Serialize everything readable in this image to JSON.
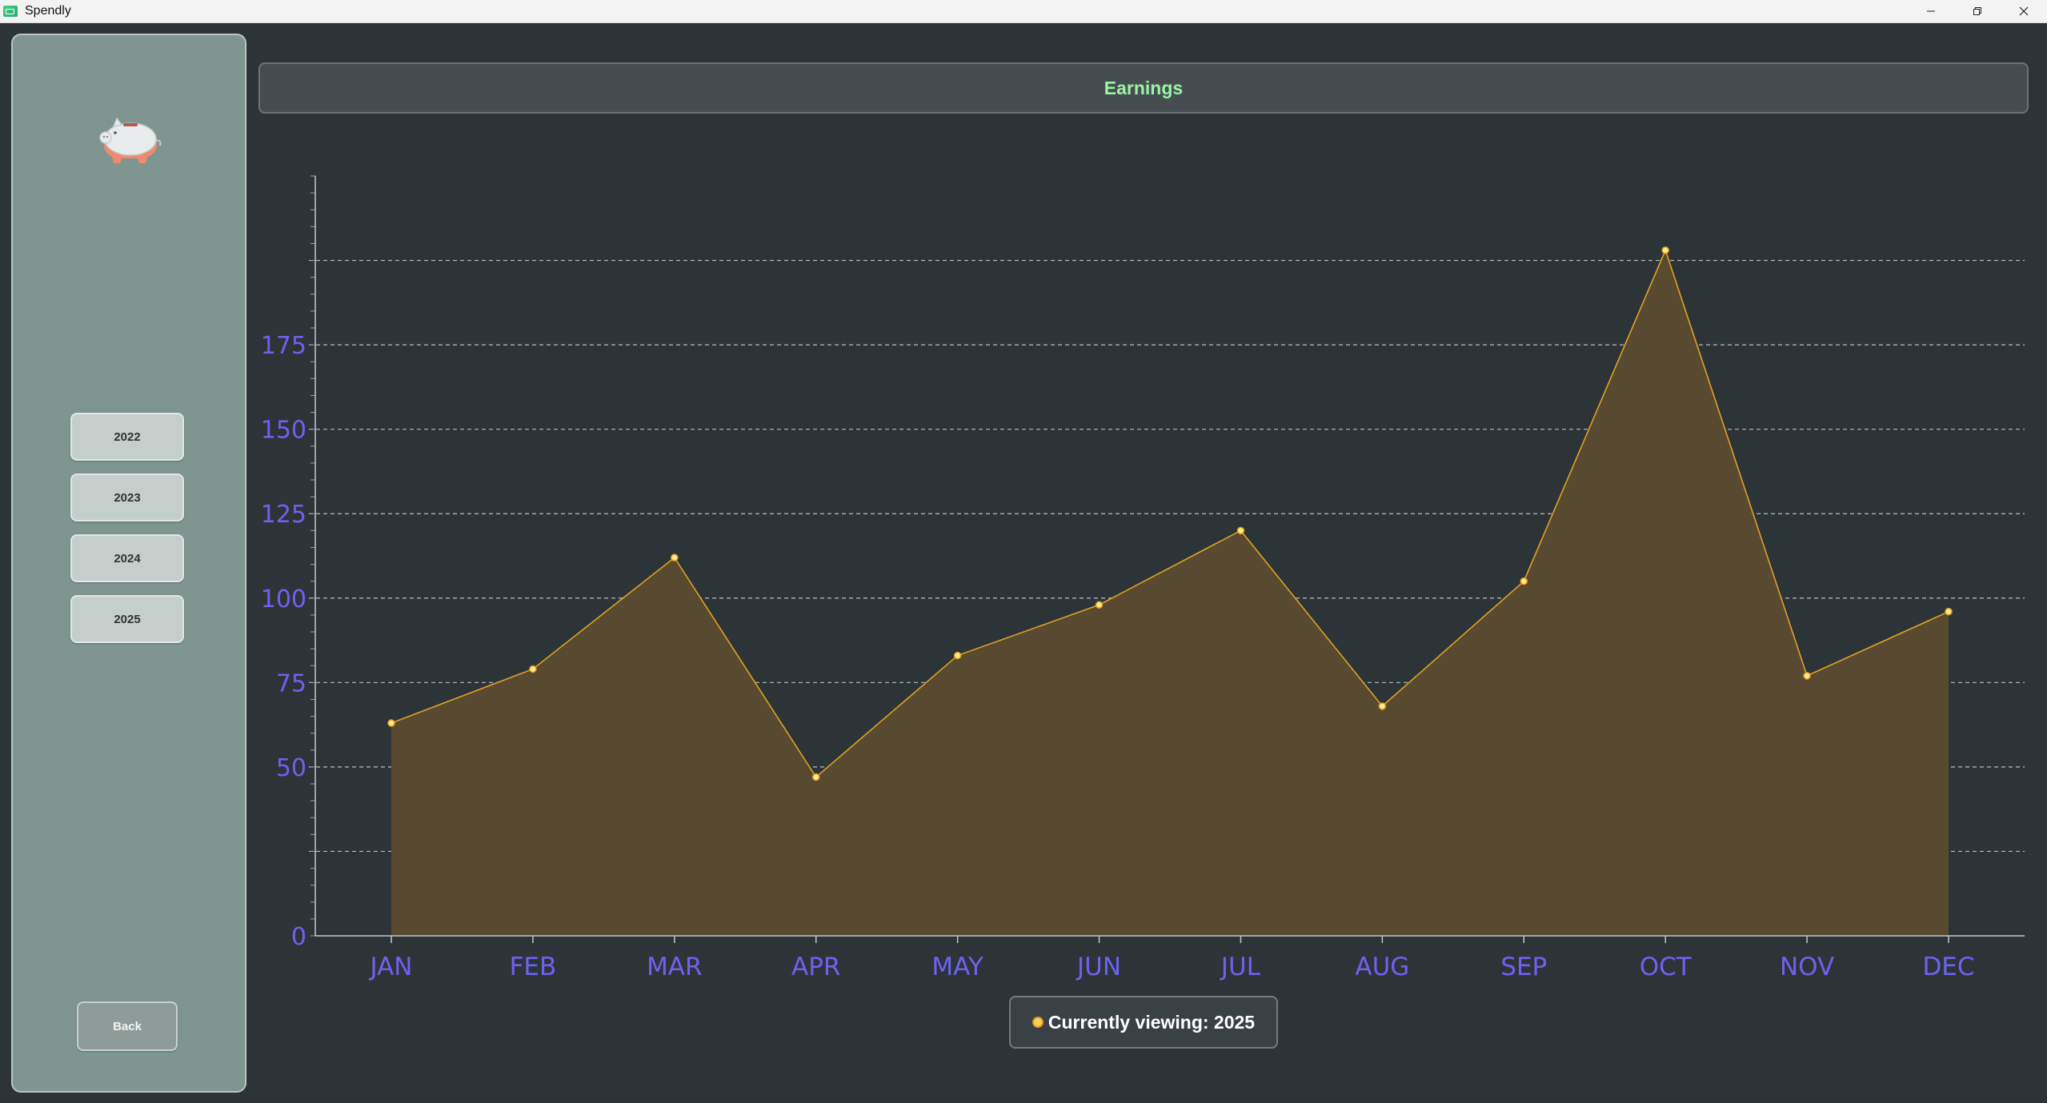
{
  "window": {
    "title": "Spendly",
    "controls": [
      "minimize",
      "restore",
      "close"
    ]
  },
  "sidebar": {
    "logo_icon": "piggy-bank-icon",
    "year_buttons": [
      "2022",
      "2023",
      "2024",
      "2025"
    ],
    "back_label": "Back"
  },
  "header": {
    "title": "Earnings"
  },
  "legend": {
    "prefix": "Currently viewing: ",
    "year": "2025",
    "text": "Currently viewing: 2025"
  },
  "colors": {
    "background": "#2d3438",
    "sidebar": "#7f9590",
    "header_text": "#9cf3a5",
    "axis_labels": "#6b63f0",
    "series_line": "#e1a122",
    "series_fill": "#574a30",
    "gridline": "#cfd3d6"
  },
  "chart_data": {
    "type": "area",
    "categories": [
      "JAN",
      "FEB",
      "MAR",
      "APR",
      "MAY",
      "JUN",
      "JUL",
      "AUG",
      "SEP",
      "OCT",
      "NOV",
      "DEC"
    ],
    "series": [
      {
        "values": [
          63,
          79,
          112,
          47,
          83,
          98,
          120,
          68,
          105,
          203,
          77,
          96
        ]
      }
    ],
    "y_ticks": [
      0,
      50,
      75,
      100,
      125,
      150,
      175
    ],
    "y_gridlines": [
      25,
      50,
      75,
      100,
      125,
      150,
      175,
      200
    ],
    "ylim": [
      0,
      225
    ],
    "grid": "horizontal dashed",
    "legend_position": "bottom-center"
  }
}
